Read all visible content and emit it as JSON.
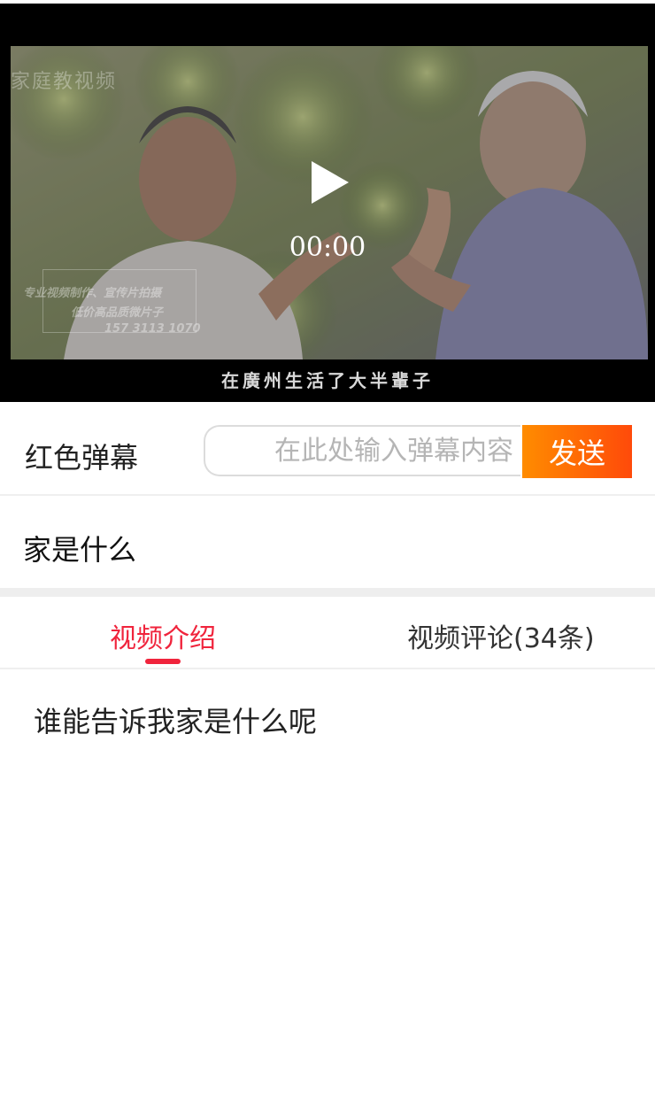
{
  "player": {
    "watermark_top": "家庭教视频",
    "watermark_lines": [
      "专业视频制作、宣传片拍摄",
      "低价高品质微片子",
      "157 3113 1070"
    ],
    "play_icon": "play-icon",
    "current_time": "00:00",
    "subtitle": "在廣州生活了大半輩子"
  },
  "danmaku": {
    "label": "红色弹幕",
    "input_value": "",
    "input_placeholder": "在此处输入弹幕内容",
    "send_label": "发送",
    "send_colors": [
      "#ff8c00",
      "#ff4a0a"
    ]
  },
  "video": {
    "title": "家是什么",
    "description": "谁能告诉我家是什么呢"
  },
  "tabs": {
    "active_color": "#f0243c",
    "items": [
      {
        "label": "视频介绍",
        "active": true
      },
      {
        "label": "视频评论(34条)",
        "active": false
      }
    ]
  }
}
